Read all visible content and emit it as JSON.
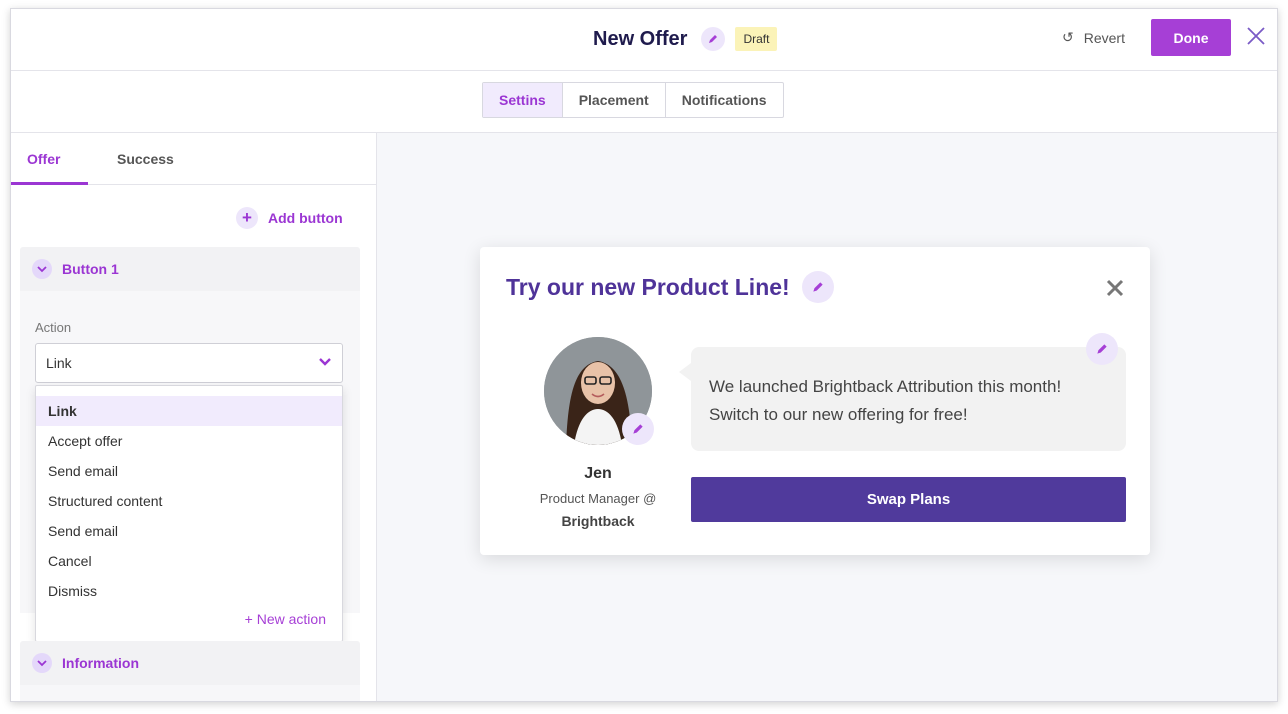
{
  "header": {
    "title": "New Offer",
    "badge": "Draft",
    "revert_label": "Revert",
    "done_label": "Done"
  },
  "tabs": [
    {
      "label": "Settins",
      "active": true
    },
    {
      "label": "Placement",
      "active": false
    },
    {
      "label": "Notifications",
      "active": false
    }
  ],
  "sidebar": {
    "subtabs": [
      {
        "label": "Offer",
        "active": true
      },
      {
        "label": "Success",
        "active": false
      }
    ],
    "add_button_label": "Add button",
    "sections": [
      {
        "title": "Button 1",
        "expanded": true
      },
      {
        "title": "Information",
        "expanded": true
      }
    ],
    "action": {
      "label": "Action",
      "selected": "Link",
      "options": [
        "Link",
        "Accept offer",
        "Send email",
        "Structured content",
        "Send email",
        "Cancel",
        "Dismiss"
      ],
      "new_action_label": "+ New action"
    }
  },
  "preview": {
    "title": "Try our new Product Line!",
    "message_lines": [
      "We launched Brightback Attribution this month!",
      "Switch to our new offering for free!"
    ],
    "person": {
      "name": "Jen",
      "role": "Product Manager @",
      "company": "Brightback"
    },
    "cta_label": "Swap Plans"
  },
  "colors": {
    "accent": "#a63fd6",
    "modal_title": "#4f3399",
    "cta": "#503a9c",
    "draft_badge": "#fbf3b8"
  },
  "icons": [
    "pencil-icon",
    "revert-icon",
    "close-icon",
    "plus-icon",
    "chevron-down-icon"
  ]
}
